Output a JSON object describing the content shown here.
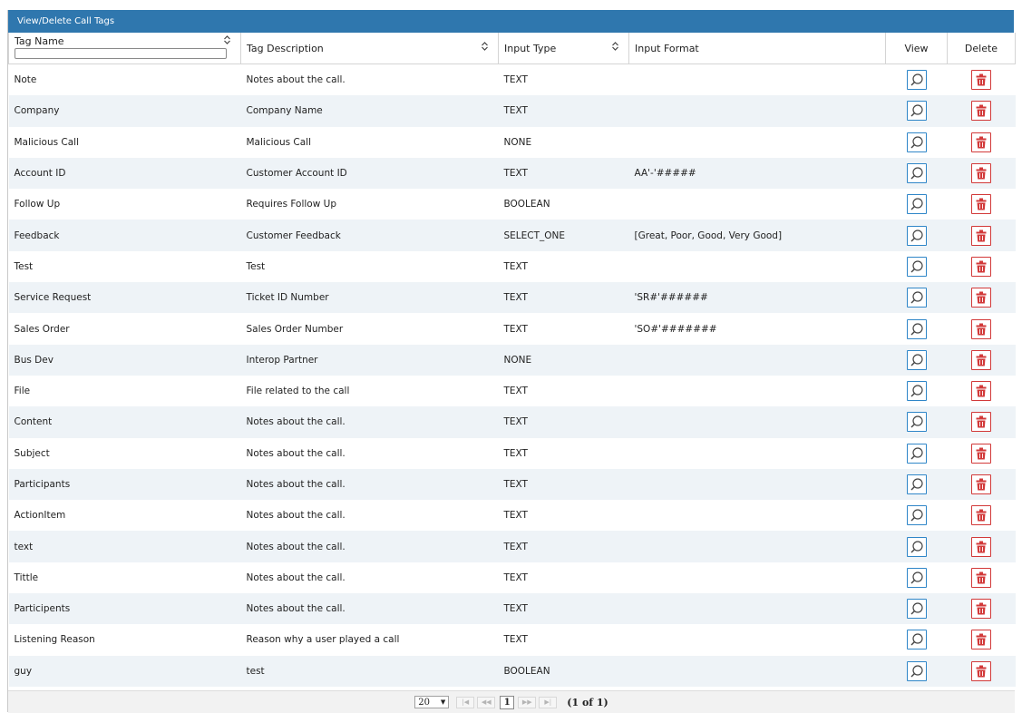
{
  "panel": {
    "title": "View/Delete Call Tags"
  },
  "columns": {
    "tag_name": "Tag Name",
    "tag_description": "Tag Description",
    "input_type": "Input Type",
    "input_format": "Input Format",
    "view": "View",
    "delete": "Delete"
  },
  "filter": {
    "value": ""
  },
  "rows": [
    {
      "name": "Note",
      "description": "Notes about the call.",
      "type": "TEXT",
      "format": ""
    },
    {
      "name": "Company",
      "description": "Company Name",
      "type": "TEXT",
      "format": ""
    },
    {
      "name": "Malicious Call",
      "description": "Malicious Call",
      "type": "NONE",
      "format": ""
    },
    {
      "name": "Account ID",
      "description": "Customer Account ID",
      "type": "TEXT",
      "format": "AA'-'#####"
    },
    {
      "name": "Follow Up",
      "description": "Requires Follow Up",
      "type": "BOOLEAN",
      "format": ""
    },
    {
      "name": "Feedback",
      "description": "Customer Feedback",
      "type": "SELECT_ONE",
      "format": "[Great, Poor, Good, Very Good]"
    },
    {
      "name": "Test",
      "description": "Test",
      "type": "TEXT",
      "format": ""
    },
    {
      "name": "Service Request",
      "description": "Ticket ID Number",
      "type": "TEXT",
      "format": "'SR#'######"
    },
    {
      "name": "Sales Order",
      "description": "Sales Order Number",
      "type": "TEXT",
      "format": "'SO#'#######"
    },
    {
      "name": "Bus Dev",
      "description": "Interop Partner",
      "type": "NONE",
      "format": ""
    },
    {
      "name": "File",
      "description": "File related to the call",
      "type": "TEXT",
      "format": ""
    },
    {
      "name": "Content",
      "description": "Notes about the call.",
      "type": "TEXT",
      "format": ""
    },
    {
      "name": "Subject",
      "description": "Notes about the call.",
      "type": "TEXT",
      "format": ""
    },
    {
      "name": "Participants",
      "description": "Notes about the call.",
      "type": "TEXT",
      "format": ""
    },
    {
      "name": "ActionItem",
      "description": "Notes about the call.",
      "type": "TEXT",
      "format": ""
    },
    {
      "name": "text",
      "description": "Notes about the call.",
      "type": "TEXT",
      "format": ""
    },
    {
      "name": "Tittle",
      "description": "Notes about the call.",
      "type": "TEXT",
      "format": ""
    },
    {
      "name": "Participents",
      "description": "Notes about the call.",
      "type": "TEXT",
      "format": ""
    },
    {
      "name": "Listening Reason",
      "description": "Reason why a user played a call",
      "type": "TEXT",
      "format": ""
    },
    {
      "name": "guy",
      "description": "test",
      "type": "BOOLEAN",
      "format": ""
    }
  ],
  "icons": {
    "sort": "sort-icon",
    "view": "magnifier-icon",
    "delete": "trash-icon",
    "first": "first-page-icon",
    "prev": "prev-page-icon",
    "next": "next-page-icon",
    "last": "last-page-icon"
  },
  "colors": {
    "header_bar": "#2f77ae",
    "row_alt": "#eef3f7",
    "view_button": "#2f86c8",
    "delete_button": "#d23939"
  },
  "pager": {
    "rows_per_page": "20",
    "rows_per_page_options": [
      "20"
    ],
    "current_page": "1",
    "report": "(1 of 1)",
    "first_glyph": "|◀",
    "prev_glyph": "◀◀",
    "next_glyph": "▶▶",
    "last_glyph": "▶|",
    "dropdown_glyph": "▼"
  }
}
